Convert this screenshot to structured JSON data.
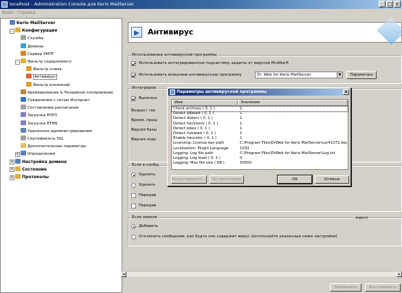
{
  "window": {
    "title": "localhost - Administration Console для Kerio MailServer",
    "menu": "Файл · Справка",
    "controls": [
      "_",
      "□",
      "x"
    ]
  },
  "tree": {
    "items": [
      {
        "label": "Kerio MailServer",
        "level": 0,
        "color": "#5a7fc0",
        "bold": true
      },
      {
        "label": "Конфигурация",
        "level": 1,
        "color": "#e0b040",
        "bold": true,
        "expander": "-"
      },
      {
        "label": "Службы",
        "level": 2,
        "color": "#a0a0a0"
      },
      {
        "label": "Домены",
        "level": 2,
        "color": "#3aa0d8"
      },
      {
        "label": "Сервер SMTP",
        "level": 2,
        "color": "#d88030"
      },
      {
        "label": "Фильтр содержимого",
        "level": 2,
        "color": "#e0b040",
        "expander": "-"
      },
      {
        "label": "Фильтр спама",
        "level": 3,
        "color": "#e0a020"
      },
      {
        "label": "Антивирус",
        "level": 3,
        "color": "#e06030",
        "selected": true
      },
      {
        "label": "Фильтр вложений",
        "level": 3,
        "color": "#e0a020"
      },
      {
        "label": "Архивирование & Резервное копирование",
        "level": 2,
        "color": "#c08040"
      },
      {
        "label": "Соединение с сетью Интернет",
        "level": 2,
        "color": "#3a70c0"
      },
      {
        "label": "Составление расписания",
        "level": 2,
        "color": "#a0a0a0"
      },
      {
        "label": "Загрузка POP3",
        "level": 2,
        "color": "#8080c0"
      },
      {
        "label": "Загрузка ETRN",
        "level": 2,
        "color": "#8080c0"
      },
      {
        "label": "Удаленное администрирование",
        "level": 2,
        "color": "#6080b0"
      },
      {
        "label": "Сертификаты SSL",
        "level": 2,
        "color": "#a0a0a0"
      },
      {
        "label": "Дополнительные параметры",
        "level": 2,
        "color": "#e0c060"
      },
      {
        "label": "Определения",
        "level": 2,
        "color": "#5a7fc0",
        "expander": "+"
      },
      {
        "label": "Настройка домена",
        "level": 1,
        "color": "#5a7fc0",
        "bold": true,
        "expander": "+"
      },
      {
        "label": "Состояние",
        "level": 1,
        "color": "#e0b040",
        "bold": true,
        "expander": "+"
      },
      {
        "label": "Протоколы",
        "level": 1,
        "color": "#e0b040",
        "bold": true,
        "expander": "+"
      }
    ]
  },
  "main": {
    "title": "Антивирус",
    "usage_group": {
      "legend": "Использование антивирусной программы",
      "cb_builtin": "Использовать интегрированную подсистему защиты от вирусов McAfee®",
      "cb_external": "Использовать внешнюю антивирусную программу",
      "combo_value": "Dr. Web for Kerio MailServer",
      "params_button": "Параметры"
    },
    "integ_group": {
      "legend": "Интегриров",
      "cb_exec": "Выполня",
      "rows": [
        "Возраст тек",
        "Время, прош",
        "Версия базы",
        "Версия подс"
      ]
    },
    "virus_group": {
      "legend": "Если в сообщ",
      "r_delete": "Удалить",
      "r_delete2": "Удалить",
      "cb_forward1": "Передав",
      "cb_forward2": "Передав"
    },
    "unscan_group": {
      "legend": "Если невозм",
      "r_add": "Добавить",
      "r_add_tail": "жден)",
      "r_reject": "Отклонить сообщение, как будто оно содержит вирус (используйте указанные ниже настройки)"
    },
    "apply_button": "Применить",
    "restore_button": "Восстановить"
  },
  "dialog": {
    "title": "Параметры антивирусной программы",
    "close": "x",
    "columns": [
      "Имя",
      "Значение"
    ],
    "rows": [
      {
        "name": "Check archives ( 0, 1 )",
        "value": "1"
      },
      {
        "name": "Detect adware ( 0, 1 )",
        "value": "1"
      },
      {
        "name": "Detect dialers ( 0, 1 )",
        "value": "1"
      },
      {
        "name": "Detect hacktools ( 0, 1 )",
        "value": "1"
      },
      {
        "name": "Detect jokes ( 0, 1 )",
        "value": "1"
      },
      {
        "name": "Detect riskware ( 0, 1 )",
        "value": "1"
      },
      {
        "name": "Enable heuristic ( 0, 1 )",
        "value": "1"
      },
      {
        "name": "Licensing: License key path",
        "value": "C:\\Program Files\\DrWeb for Kerio MailServer\\usr41372.key"
      },
      {
        "name": "Localization: Plugin Language",
        "value": "1033"
      },
      {
        "name": "Logging: Log file path",
        "value": "C:\\Program Files\\DrWeb for Kerio MailServer\\Log.txt"
      },
      {
        "name": "Logging: Log level ( 0, 1 )",
        "value": "0"
      },
      {
        "name": "Logging: Max file size ( KB )",
        "value": "50000"
      }
    ],
    "edit_button": "Редактировать...",
    "default_button": "По умолчанию",
    "ok_button": "OK",
    "cancel_button": "Отмена"
  }
}
